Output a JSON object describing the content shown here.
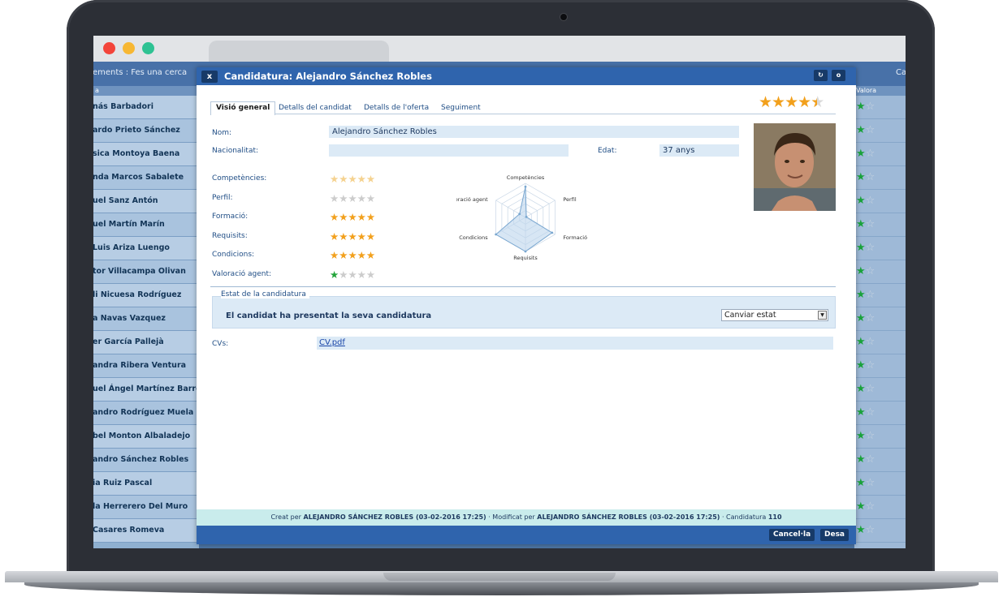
{
  "browser": {
    "dots": [
      "#f3443a",
      "#f7b733",
      "#2ec293"
    ]
  },
  "nav": {
    "breadcrumb": "ements : Fes una cerca",
    "right_text": "Ca"
  },
  "list": {
    "header": "a",
    "rows": [
      "nás Barbadori",
      "ardo Prieto Sánchez",
      "sica Montoya Baena",
      "nda Marcos Sabalete",
      "uel Sanz Antón",
      "uel Martín Marín",
      "Luis Ariza Luengo",
      "tor Villacampa Olivan",
      "li Nicuesa Rodríguez",
      "a Navas Vazquez",
      "er García Pallejà",
      "andra Ribera Ventura",
      "uel Ángel Martínez Barre...",
      "andro Rodríguez Muela",
      "bel Monton Albaladejo",
      "andro Sánchez Robles",
      "ia Ruiz Pascal",
      "la Herrerero Del Muro",
      "Casares Romeva"
    ]
  },
  "rlist": {
    "header": "Valora"
  },
  "dialog": {
    "close_label": "x",
    "title": "Candidatura: Alejandro Sánchez Robles",
    "refresh_label": "↻",
    "maximize_label": "o",
    "tabs": [
      "Visió general",
      "Detalls del candidat",
      "Detalls de l'oferta",
      "Seguiment"
    ],
    "overall_rating": 4.5,
    "labels": {
      "nom": "Nom:",
      "nacionalitat": "Nacionalitat:",
      "edat": "Edat:",
      "cvs": "CVs:"
    },
    "values": {
      "nom": "Alejandro Sánchez Robles",
      "nacionalitat": "",
      "edat": "37 anys",
      "cv": "CV.pdf"
    },
    "ratings": [
      {
        "label": "Competències:",
        "value": 4.5,
        "style": "pale"
      },
      {
        "label": "Perfil:",
        "value": 0,
        "style": "off"
      },
      {
        "label": "Formació:",
        "value": 4.5,
        "style": "on"
      },
      {
        "label": "Requisits:",
        "value": 5,
        "style": "on"
      },
      {
        "label": "Condicions:",
        "value": 5,
        "style": "on"
      },
      {
        "label": "Valoració agent:",
        "value": 1,
        "style": "green"
      }
    ],
    "radar": {
      "axes": [
        "Competències",
        "Perfil",
        "Formació",
        "Requisits",
        "Condicions",
        "Valoració agent"
      ],
      "values": [
        4.5,
        0,
        4.5,
        5,
        5,
        1
      ],
      "max": 5
    },
    "estat": {
      "section_label": "Estat de la candidatura",
      "text": "El candidat ha presentat la seva candidatura",
      "select_value": "Canviar estat"
    },
    "footer": {
      "prefix1": "Creat per ",
      "creator": "ALEJANDRO SÁNCHEZ ROBLES (03-02-2016 17:25)",
      "prefix2": " · Modificat per ",
      "modifier": "ALEJANDRO SÁNCHEZ ROBLES (03-02-2016 17:25)",
      "prefix3": " · Candidatura ",
      "number": "110"
    },
    "buttons": {
      "cancel": "Cancel·la",
      "save": "Desa"
    }
  },
  "colors": {
    "accent": "#2f64ad",
    "star": "#f2a01c",
    "agent_star": "#22a43a"
  }
}
